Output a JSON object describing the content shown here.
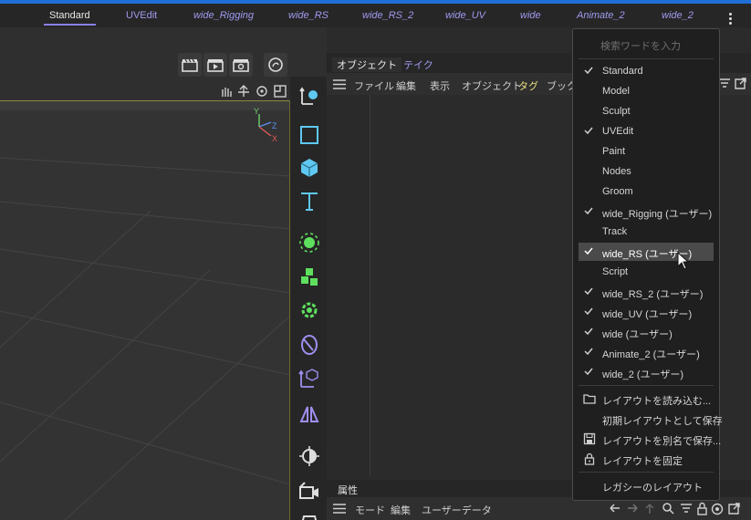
{
  "layout_tabs": [
    "Standard",
    "UVEdit",
    "wide_Rigging",
    "wide_RS",
    "wide_RS_2",
    "wide_UV",
    "wide",
    "Animate_2",
    "wide_2"
  ],
  "active_layout": "Standard",
  "object_panel": {
    "tabs": [
      "オブジェクト",
      "テイク"
    ],
    "menu": [
      "ファイル",
      "編集",
      "表示",
      "オブジェクト",
      "タグ",
      "ブックマ"
    ]
  },
  "attribute_panel": {
    "tab": "属性",
    "menu": [
      "モード",
      "編集",
      "ユーザーデータ"
    ]
  },
  "dropdown": {
    "search_placeholder": "検索ワードを入力",
    "items": [
      {
        "label": "Standard",
        "checked": true
      },
      {
        "label": "Model",
        "checked": false
      },
      {
        "label": "Sculpt",
        "checked": false
      },
      {
        "label": "UVEdit",
        "checked": true
      },
      {
        "label": "Paint",
        "checked": false
      },
      {
        "label": "Nodes",
        "checked": false
      },
      {
        "label": "Groom",
        "checked": false
      },
      {
        "label": "wide_Rigging (ユーザー)",
        "checked": true
      },
      {
        "label": "Track",
        "checked": false
      },
      {
        "label": "wide_RS (ユーザー)",
        "checked": true
      },
      {
        "label": "Script",
        "checked": false
      },
      {
        "label": "wide_RS_2 (ユーザー)",
        "checked": true
      },
      {
        "label": "wide_UV (ユーザー)",
        "checked": true
      },
      {
        "label": "wide (ユーザー)",
        "checked": true
      },
      {
        "label": "Animate_2 (ユーザー)",
        "checked": true
      },
      {
        "label": "wide_2 (ユーザー)",
        "checked": true
      }
    ],
    "hovered_item": "wide_RS (ユーザー)",
    "actions": [
      {
        "label": "レイアウトを読み込む...",
        "icon": "folder-icon"
      },
      {
        "label": "初期レイアウトとして保存",
        "icon": ""
      },
      {
        "label": "レイアウトを別名で保存...",
        "icon": "save-icon"
      },
      {
        "label": "レイアウトを固定",
        "icon": "lock-icon"
      }
    ],
    "legacy": "レガシーのレイアウト"
  },
  "axis_labels": [
    "Y",
    "Z",
    "X"
  ],
  "colors": {
    "accent_top": "#1f6fd6",
    "layout_tab_text": "#a09af0",
    "tag_menu": "#e6e080",
    "dock_icon_cyan": "#5fc8f0",
    "dock_icon_green": "#5ee05e",
    "dock_icon_purple": "#a08ef0"
  }
}
